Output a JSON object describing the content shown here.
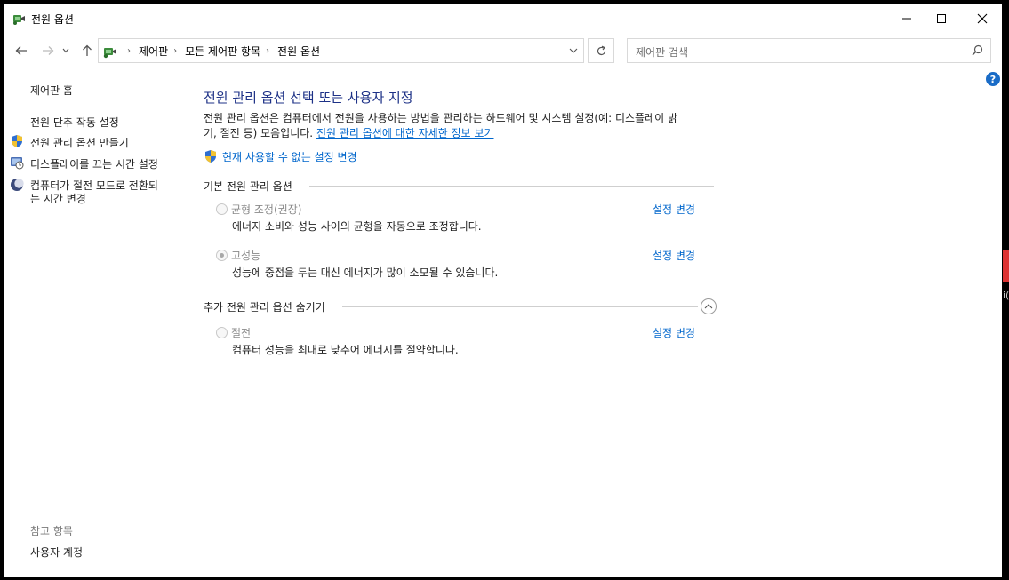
{
  "window": {
    "title": "전원 옵션"
  },
  "nav": {
    "breadcrumbs": [
      "제어판",
      "모든 제어판 항목",
      "전원 옵션"
    ],
    "search_placeholder": "제어판 검색"
  },
  "sidebar": {
    "home": "제어판 홈",
    "items": [
      {
        "label": "전원 단추 작동 설정",
        "icon": "none"
      },
      {
        "label": "전원 관리 옵션 만들기",
        "icon": "shield-icon"
      },
      {
        "label": "디스플레이를 끄는 시간 설정",
        "icon": "monitor-clock-icon"
      },
      {
        "label_line1": "컴퓨터가 절전 모드로 전환되",
        "label_line2": "는 시간 변경",
        "icon": "moon-icon"
      }
    ],
    "see_also_title": "참고 항목",
    "see_also_items": [
      "사용자 계정"
    ]
  },
  "main": {
    "title": "전원 관리 옵션 선택 또는 사용자 지정",
    "description_line1": "전원 관리 옵션은 컴퓨터에서 전원을 사용하는 방법을 관리하는 하드웨어 및 시스템 설정(예: 디스플레이 밝",
    "description_line2": "기, 절전 등) 모음입니다.",
    "info_link": "전원 관리 옵션에 대한 자세한 정보 보기",
    "change_unavailable": "현재 사용할 수 없는 설정 변경",
    "basic_group_title": "기본 전원 관리 옵션",
    "extra_group_title": "추가 전원 관리 옵션 숨기기",
    "plans": [
      {
        "name": "균형 조정(권장)",
        "description": "에너지 소비와 성능 사이의 균형을 자동으로 조정합니다.",
        "link": "설정 변경",
        "selected": false
      },
      {
        "name": "고성능",
        "description": "성능에 중점을 두는 대신 에너지가 많이 소모될 수 있습니다.",
        "link": "설정 변경",
        "selected": true
      },
      {
        "name": "절전",
        "description": "컴퓨터 성능을 최대로 낮추어 에너지를 절약합니다.",
        "link": "설정 변경",
        "selected": false
      }
    ]
  },
  "outside": {
    "text": "i("
  },
  "colors": {
    "title_blue": "#1e3287",
    "link_blue": "#0066cc",
    "help_blue": "#1a6cc7"
  }
}
